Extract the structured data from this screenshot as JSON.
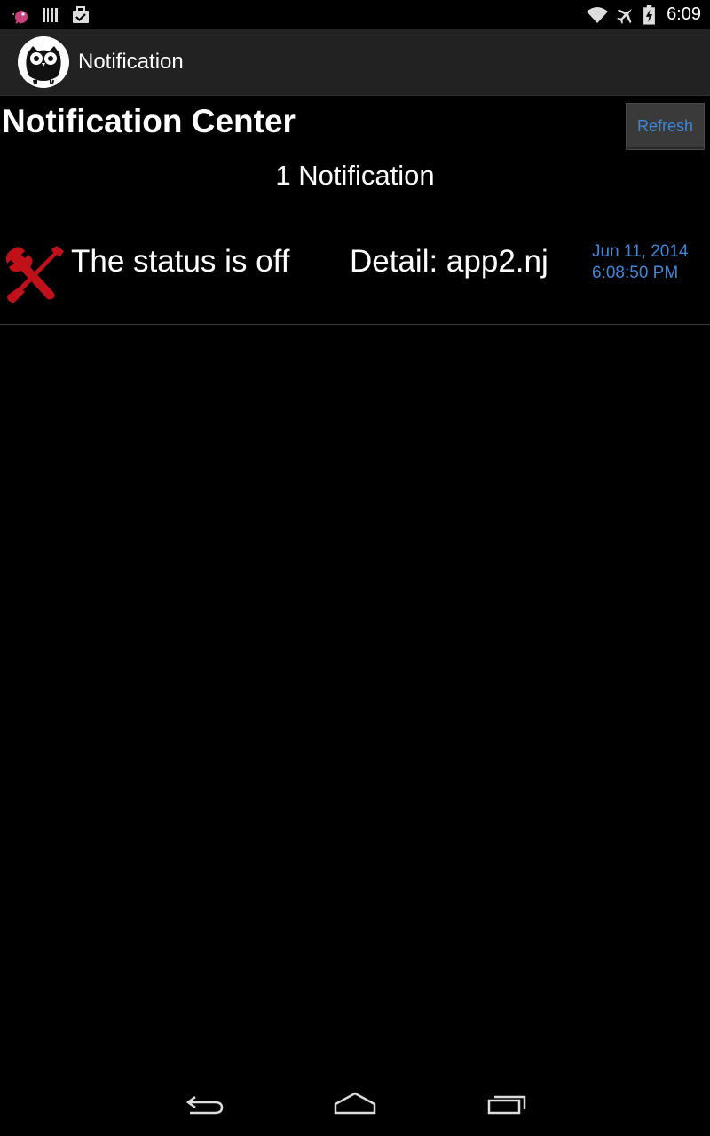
{
  "status_bar": {
    "time": "6:09",
    "icons": [
      "bird-icon",
      "barcode-icon",
      "briefcase-check-icon",
      "wifi-icon",
      "airplane-icon",
      "battery-charging-icon"
    ]
  },
  "action_bar": {
    "title": "Notification",
    "logo_icon": "owl-icon"
  },
  "page": {
    "title": "Notification Center",
    "refresh_label": "Refresh",
    "count_label": "1 Notification"
  },
  "notifications": [
    {
      "icon": "tools-wrench-screwdriver-icon",
      "message": "The status is off",
      "detail": "Detail: app2.nj",
      "date": "Jun 11, 2014",
      "time": "6:08:50 PM"
    }
  ],
  "nav_bar": {
    "icons": [
      "back-icon",
      "home-icon",
      "recents-icon"
    ]
  },
  "colors": {
    "accent_blue": "#3d86d8",
    "icon_red": "#c0111a",
    "action_bar_bg": "#222222"
  }
}
